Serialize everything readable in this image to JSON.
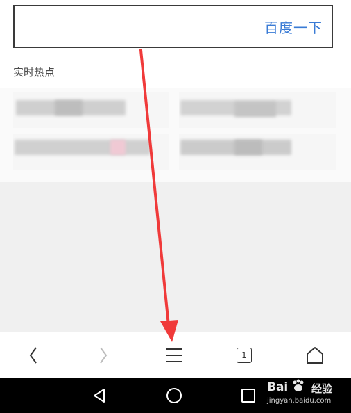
{
  "search": {
    "value": "",
    "placeholder": "",
    "button_label": "百度一下"
  },
  "hot": {
    "title": "实时热点",
    "items": [
      "",
      "",
      "",
      ""
    ]
  },
  "browser_bar": {
    "tab_count": "1",
    "icons": [
      "back-icon",
      "forward-icon",
      "menu-icon",
      "tabs-icon",
      "home-icon"
    ]
  },
  "android_nav": {
    "icons": [
      "back-triangle-icon",
      "home-circle-icon",
      "recents-square-icon"
    ]
  },
  "watermark": {
    "logo": "Bai",
    "brand": "经验",
    "url": "jingyan.baidu.com"
  },
  "annotation": {
    "color": "#f03a3a",
    "icon": "red-arrow-annotation"
  },
  "colors": {
    "accent": "#3a7bd5",
    "annotation": "#f03a3a"
  }
}
